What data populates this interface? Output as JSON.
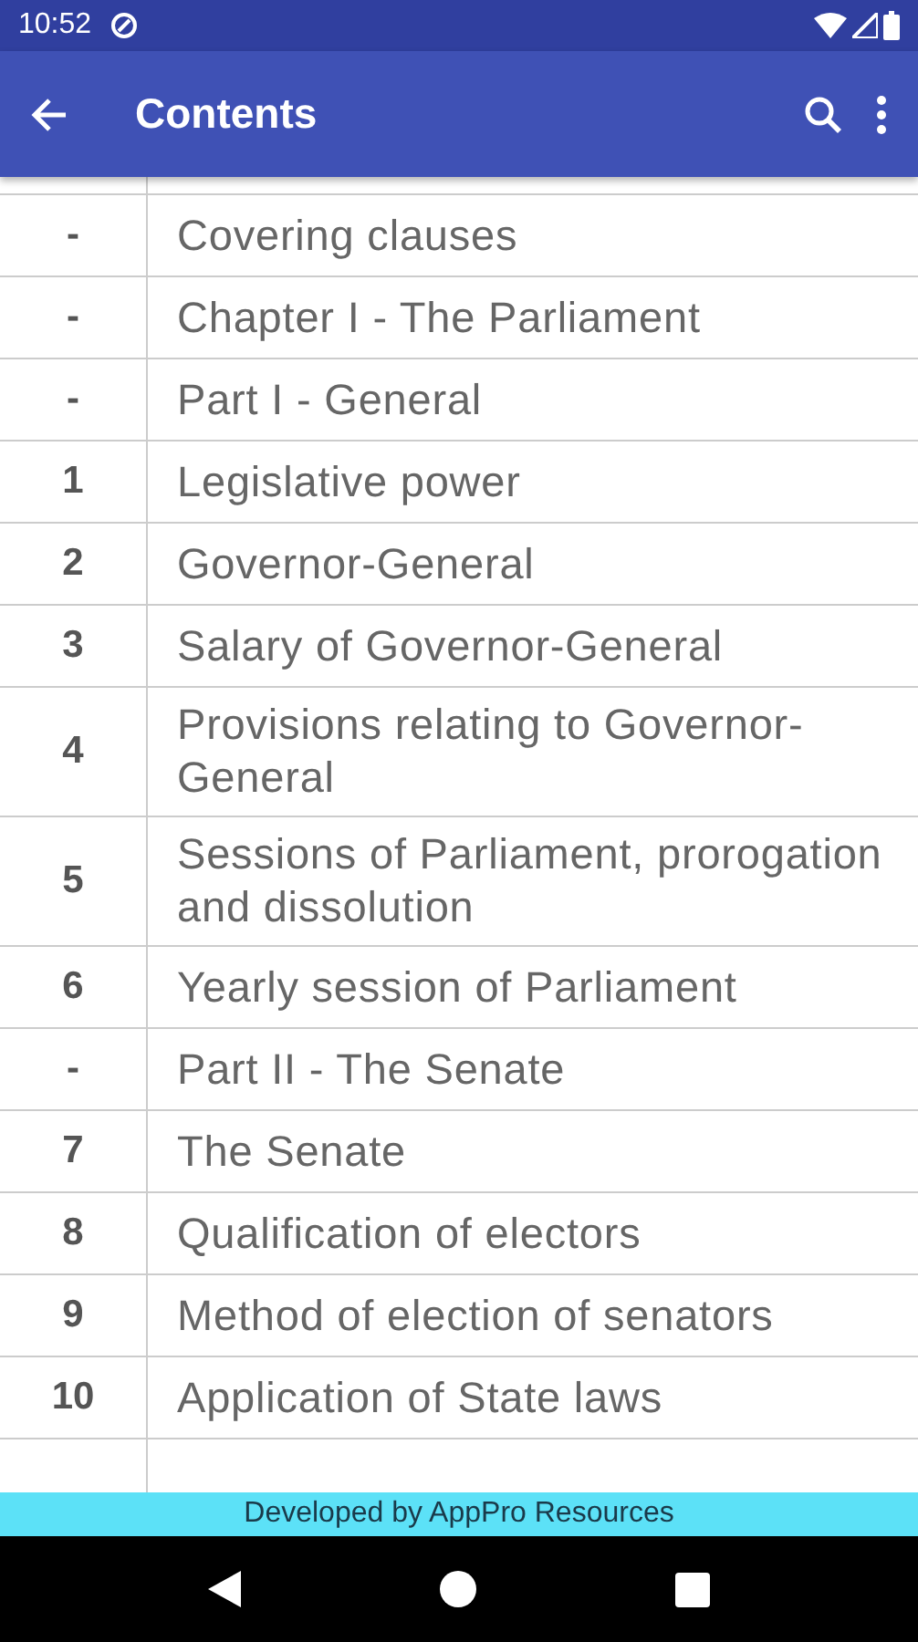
{
  "status_bar": {
    "time": "10:52"
  },
  "app_bar": {
    "title": "Contents"
  },
  "rows": [
    {
      "number": "-",
      "title": "Covering clauses"
    },
    {
      "number": "-",
      "title": "Chapter I - The Parliament"
    },
    {
      "number": "-",
      "title": "Part I - General"
    },
    {
      "number": "1",
      "title": "Legislative power"
    },
    {
      "number": "2",
      "title": "Governor-General"
    },
    {
      "number": "3",
      "title": "Salary of Governor-General"
    },
    {
      "number": "4",
      "title": "Provisions relating to Governor-General"
    },
    {
      "number": "5",
      "title": "Sessions of Parliament, prorogation and dissolution"
    },
    {
      "number": "6",
      "title": "Yearly session of Parliament"
    },
    {
      "number": "-",
      "title": "Part II - The Senate"
    },
    {
      "number": "7",
      "title": "The Senate"
    },
    {
      "number": "8",
      "title": "Qualification of electors"
    },
    {
      "number": "9",
      "title": "Method of election of senators"
    },
    {
      "number": "10",
      "title": "Application of State laws"
    }
  ],
  "footer_banner": "Developed by AppPro Resources"
}
